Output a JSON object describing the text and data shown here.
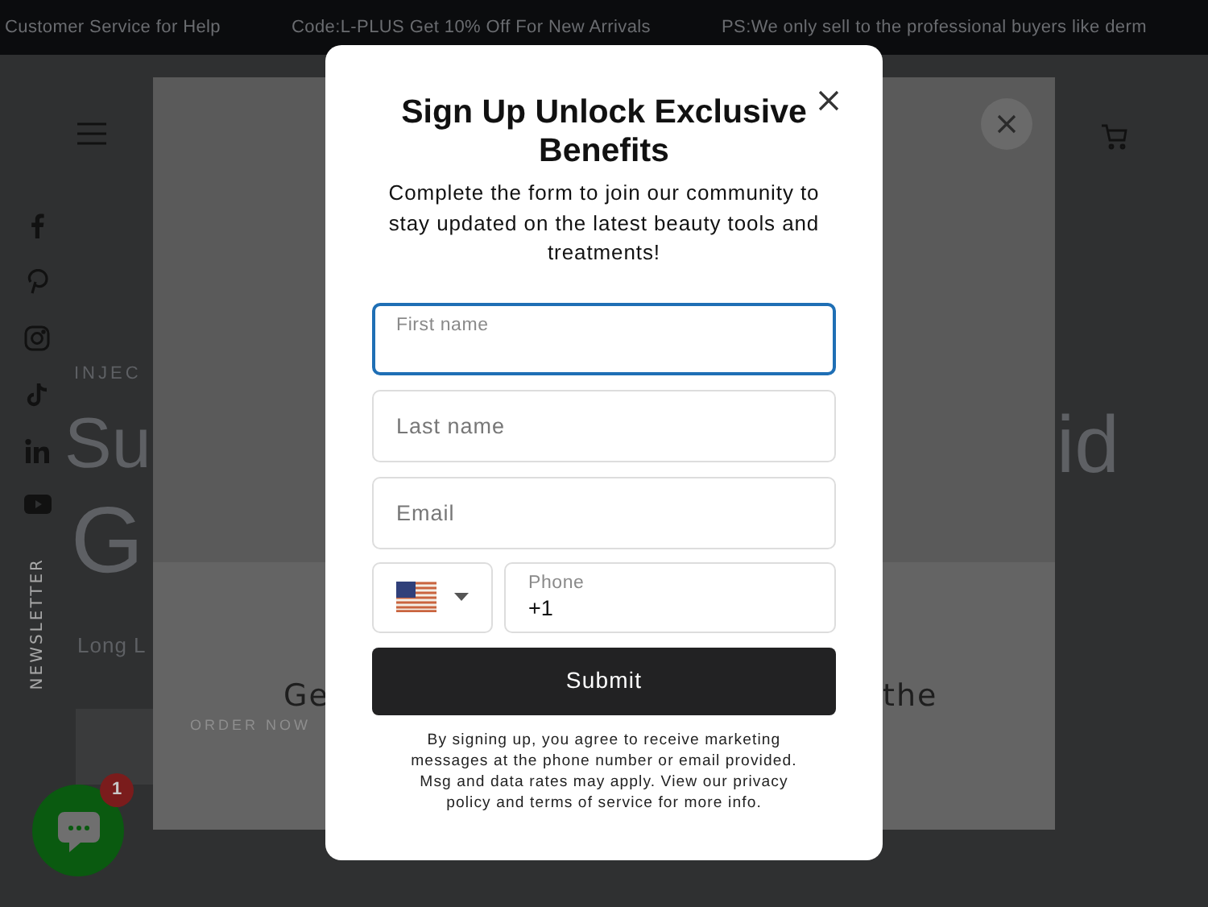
{
  "announcements": [
    "Customer Service for Help",
    "Code:L-PLUS Get 10% Off For New Arrivals",
    "PS:We only sell to the professional buyers like derm"
  ],
  "sidebar": {
    "newsletter_label": "NEWSLETTER"
  },
  "hero": {
    "eyebrow": "INJEC",
    "heading_line_1": "Su",
    "heading_line_2": "G",
    "heading_right": "id",
    "subtitle": "Long L",
    "button": "ORDER NOW"
  },
  "back_panel": {
    "text_left": "Ge",
    "text_right": "the"
  },
  "modal": {
    "title": "Sign Up Unlock Exclusive Benefits",
    "description": "Complete the form to join our community to stay updated on the latest beauty tools and treatments!",
    "fields": [
      {
        "placeholder": "First name",
        "focused": true
      },
      {
        "placeholder": "Last name",
        "focused": false
      },
      {
        "placeholder": "Email",
        "focused": false
      }
    ],
    "phone": {
      "label": "Phone",
      "value": "+1"
    },
    "submit": "Submit",
    "disclaimer": "By signing up, you agree to receive marketing messages at the phone number or email provided. Msg and data rates may apply. View our privacy policy and terms of service for more info."
  },
  "chat": {
    "badge": "1"
  }
}
